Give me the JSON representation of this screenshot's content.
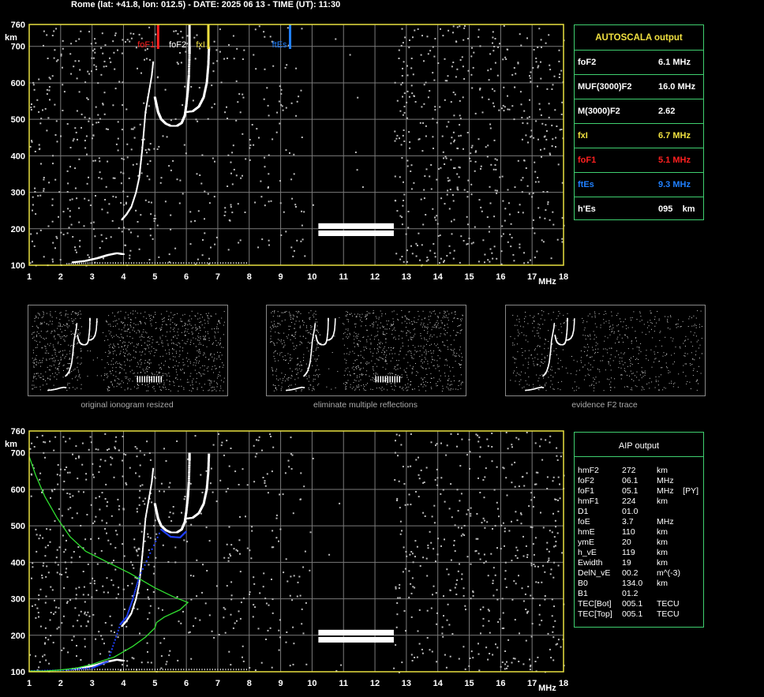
{
  "header": "Rome (lat: +41.8, lon: 012.5) - DATE: 2025 06 13 - TIME (UT): 11:30",
  "colors": {
    "frame": "#e8e040",
    "grid": "#7a7a7a",
    "trace": "#ffffff",
    "foF1": "#ff2020",
    "foF2": "#ffffff",
    "fxI": "#f0e040",
    "ftEs": "#2080ff",
    "profile": "#30e030",
    "aip_trace": "#2040ff",
    "panel_border": "#3fcf6f"
  },
  "chart_data": [
    {
      "type": "scatter",
      "name": "ionogram-top",
      "xlabel": "MHz",
      "ylabel": "km",
      "xlim": [
        1,
        18
      ],
      "ylim": [
        100,
        760
      ],
      "x_ticks": [
        "1",
        "2",
        "3",
        "4",
        "5",
        "6",
        "7",
        "8",
        "9",
        "10",
        "11",
        "12",
        "13",
        "14",
        "15",
        "16",
        "17",
        "18"
      ],
      "y_ticks": [
        "100",
        "200",
        "300",
        "400",
        "500",
        "600",
        "700",
        "760"
      ],
      "grid": true,
      "markers": [
        {
          "label": "foF1",
          "freq": 5.1
        },
        {
          "label": "foF2",
          "freq": 6.1
        },
        {
          "label": "fxI",
          "freq": 6.7
        },
        {
          "label": "ftEs",
          "freq": 9.3
        }
      ],
      "f2_trace": [
        [
          5.0,
          560
        ],
        [
          5.05,
          540
        ],
        [
          5.1,
          520
        ],
        [
          5.2,
          500
        ],
        [
          5.35,
          488
        ],
        [
          5.5,
          482
        ],
        [
          5.7,
          482
        ],
        [
          5.85,
          490
        ],
        [
          5.95,
          510
        ],
        [
          6.0,
          540
        ],
        [
          6.05,
          580
        ],
        [
          6.08,
          620
        ],
        [
          6.1,
          680
        ],
        [
          6.1,
          700
        ]
      ],
      "fx_trace": [
        [
          6.0,
          520
        ],
        [
          6.2,
          522
        ],
        [
          6.4,
          535
        ],
        [
          6.55,
          560
        ],
        [
          6.65,
          600
        ],
        [
          6.7,
          650
        ],
        [
          6.72,
          700
        ]
      ],
      "f1_trace": [
        [
          3.95,
          225
        ],
        [
          4.1,
          240
        ],
        [
          4.25,
          260
        ],
        [
          4.4,
          300
        ],
        [
          4.5,
          340
        ],
        [
          4.55,
          380
        ],
        [
          4.6,
          420
        ],
        [
          4.65,
          470
        ],
        [
          4.7,
          520
        ],
        [
          4.8,
          570
        ],
        [
          4.9,
          620
        ],
        [
          4.95,
          660
        ]
      ],
      "e_trace": [
        [
          2.4,
          108
        ],
        [
          2.8,
          112
        ],
        [
          3.2,
          120
        ],
        [
          3.5,
          128
        ],
        [
          3.8,
          133
        ],
        [
          4.0,
          130
        ]
      ],
      "es_trace": [
        [
          2.2,
          104
        ],
        [
          3.0,
          106
        ],
        [
          4.0,
          106
        ],
        [
          5.0,
          106
        ],
        [
          6.0,
          106
        ],
        [
          7.0,
          106
        ],
        [
          8.0,
          106
        ]
      ],
      "interference_block": {
        "x": [
          10.2,
          12.6
        ],
        "y": [
          180,
          215
        ]
      }
    },
    {
      "type": "scatter",
      "name": "ionogram-bottom",
      "xlabel": "MHz",
      "ylabel": "km",
      "xlim": [
        1,
        18
      ],
      "ylim": [
        100,
        760
      ],
      "x_ticks": [
        "1",
        "2",
        "3",
        "4",
        "5",
        "6",
        "7",
        "8",
        "9",
        "10",
        "11",
        "12",
        "13",
        "14",
        "15",
        "16",
        "17",
        "18"
      ],
      "y_ticks": [
        "100",
        "200",
        "300",
        "400",
        "500",
        "600",
        "700",
        "760"
      ],
      "grid": true,
      "profile": [
        [
          1.0,
          690
        ],
        [
          1.2,
          640
        ],
        [
          1.5,
          580
        ],
        [
          1.9,
          520
        ],
        [
          2.3,
          470
        ],
        [
          2.8,
          430
        ],
        [
          3.5,
          400
        ],
        [
          4.2,
          370
        ],
        [
          5.0,
          330
        ],
        [
          5.6,
          305
        ],
        [
          6.05,
          290
        ],
        [
          5.8,
          270
        ],
        [
          5.3,
          250
        ],
        [
          5.05,
          235
        ],
        [
          5.0,
          220
        ],
        [
          4.7,
          195
        ],
        [
          4.3,
          170
        ],
        [
          3.9,
          150
        ],
        [
          3.7,
          140
        ],
        [
          3.4,
          132
        ],
        [
          3.0,
          120
        ],
        [
          2.5,
          110
        ],
        [
          2.0,
          105
        ],
        [
          1.5,
          102
        ],
        [
          1.0,
          102
        ]
      ],
      "aip_trace": [
        [
          1.0,
          102
        ],
        [
          2.0,
          104
        ],
        [
          3.0,
          110
        ],
        [
          3.5,
          128
        ],
        [
          3.9,
          230
        ],
        [
          4.1,
          250
        ],
        [
          4.3,
          300
        ],
        [
          4.5,
          360
        ],
        [
          5.2,
          490
        ],
        [
          5.5,
          470
        ],
        [
          5.8,
          468
        ],
        [
          6.0,
          485
        ]
      ],
      "interference_block": {
        "x": [
          10.2,
          12.6
        ],
        "y": [
          180,
          215
        ]
      }
    }
  ],
  "autoscala": {
    "title": "AUTOSCALA output",
    "rows": [
      {
        "label": "foF2",
        "value": "6.1 MHz",
        "color": "#ffffff"
      },
      {
        "label": "MUF(3000)F2",
        "value": "16.0 MHz",
        "color": "#ffffff"
      },
      {
        "label": "M(3000)F2",
        "value": "2.62",
        "color": "#ffffff"
      },
      {
        "label": "fxI",
        "value": "6.7 MHz",
        "color": "#f0e040"
      },
      {
        "label": "foF1",
        "value": "5.1 MHz",
        "color": "#ff2020"
      },
      {
        "label": "ftEs",
        "value": "9.3 MHz",
        "color": "#2080ff"
      },
      {
        "label": "h'Es",
        "value": "095    km",
        "color": "#ffffff"
      }
    ]
  },
  "aip": {
    "title": "AIP output",
    "rows": [
      {
        "name": "hmF2",
        "val": "272",
        "unit": "km"
      },
      {
        "name": "foF2",
        "val": "06.1",
        "unit": "MHz"
      },
      {
        "name": "foF1",
        "val": "05.1",
        "unit": "MHz    [PY]"
      },
      {
        "name": "hmF1",
        "val": "224",
        "unit": "km"
      },
      {
        "name": "D1",
        "val": "01.0",
        "unit": ""
      },
      {
        "name": "foE",
        "val": "3.7",
        "unit": "MHz"
      },
      {
        "name": "hmE",
        "val": "110",
        "unit": "km"
      },
      {
        "name": "ymE",
        "val": "20",
        "unit": "km"
      },
      {
        "name": "h_vE",
        "val": "119",
        "unit": "km"
      },
      {
        "name": "Ewidth",
        "val": "19",
        "unit": "km"
      },
      {
        "name": "DelN_vE",
        "val": "00.2",
        "unit": "m^(-3)"
      },
      {
        "name": "B0",
        "val": "134.0",
        "unit": "km"
      },
      {
        "name": "B1",
        "val": "01.2",
        "unit": ""
      },
      {
        "name": "TEC[Bot]",
        "val": "005.1",
        "unit": "TECU"
      },
      {
        "name": "TEC[Top]",
        "val": "005.1",
        "unit": "TECU"
      }
    ]
  },
  "thumbnails": [
    {
      "caption": "original ionogram resized"
    },
    {
      "caption": "eliminate multiple reflections"
    },
    {
      "caption": "evidence F2 trace"
    }
  ]
}
